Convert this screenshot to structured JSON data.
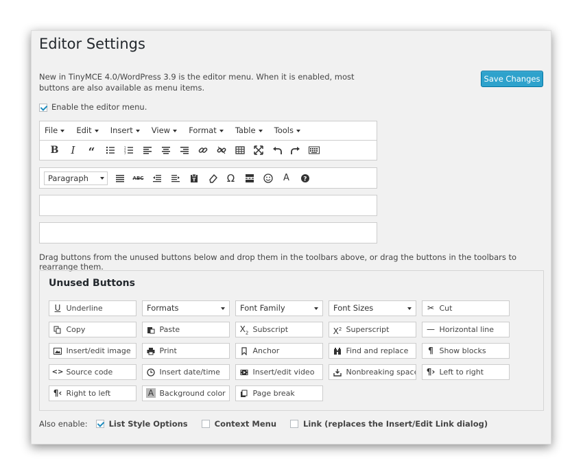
{
  "title": "Editor Settings",
  "intro": "New in TinyMCE 4.0/WordPress 3.9 is the editor menu. When it is enabled, most buttons are also available as menu items.",
  "save_label": "Save Changes",
  "enable_menu": {
    "label": "Enable the editor menu.",
    "checked": true
  },
  "menubar": [
    "File",
    "Edit",
    "Insert",
    "View",
    "Format",
    "Table",
    "Tools"
  ],
  "toolbar1_icons": [
    "bold-icon",
    "italic-icon",
    "blockquote-icon",
    "bullet-list-icon",
    "numbered-list-icon",
    "align-left-icon",
    "align-center-icon",
    "align-right-icon",
    "link-icon",
    "unlink-icon",
    "table-icon",
    "fullscreen-icon",
    "undo-icon",
    "redo-icon",
    "toolbar-toggle-icon"
  ],
  "toolbar2": {
    "format_select": "Paragraph",
    "icons": [
      "justify-icon",
      "strikethrough-icon",
      "outdent-icon",
      "indent-icon",
      "paste-text-icon",
      "clear-formatting-icon",
      "special-character-icon",
      "read-more-icon",
      "emoticons-icon",
      "text-color-icon",
      "help-icon"
    ]
  },
  "drag_hint": "Drag buttons from the unused buttons below and drop them in the toolbars above, or drag the buttons in the toolbars to rearrange them.",
  "unused": {
    "heading": "Unused Buttons",
    "buttons": [
      {
        "label": "Underline",
        "icon": "underline-icon"
      },
      {
        "label": "Formats",
        "icon": "",
        "select": true
      },
      {
        "label": "Font Family",
        "icon": "",
        "select": true
      },
      {
        "label": "Font Sizes",
        "icon": "",
        "select": true
      },
      {
        "label": "Cut",
        "icon": "scissors-icon"
      },
      {
        "label": "Copy",
        "icon": "copy-icon"
      },
      {
        "label": "Paste",
        "icon": "paste-icon"
      },
      {
        "label": "Subscript",
        "icon": "subscript-icon"
      },
      {
        "label": "Superscript",
        "icon": "superscript-icon"
      },
      {
        "label": "Horizontal line",
        "icon": "horizontal-line-icon"
      },
      {
        "label": "Insert/edit image",
        "icon": "image-icon"
      },
      {
        "label": "Print",
        "icon": "print-icon"
      },
      {
        "label": "Anchor",
        "icon": "bookmark-icon"
      },
      {
        "label": "Find and replace",
        "icon": "binoculars-icon"
      },
      {
        "label": "Show blocks",
        "icon": "pilcrow-icon"
      },
      {
        "label": "Source code",
        "icon": "code-icon"
      },
      {
        "label": "Insert date/time",
        "icon": "clock-icon"
      },
      {
        "label": "Insert/edit video",
        "icon": "film-icon"
      },
      {
        "label": "Nonbreaking space",
        "icon": "nonbreaking-icon"
      },
      {
        "label": "Left to right",
        "icon": "ltr-icon"
      },
      {
        "label": "Right to left",
        "icon": "rtl-icon"
      },
      {
        "label": "Background color",
        "icon": "background-color-icon"
      },
      {
        "label": "Page break",
        "icon": "page-break-icon"
      }
    ]
  },
  "also_enable": {
    "label": "Also enable:",
    "options": [
      {
        "label": "List Style Options",
        "checked": true
      },
      {
        "label": "Context Menu",
        "checked": false
      },
      {
        "label": "Link (replaces the Insert/Edit Link dialog)",
        "checked": false
      }
    ]
  }
}
